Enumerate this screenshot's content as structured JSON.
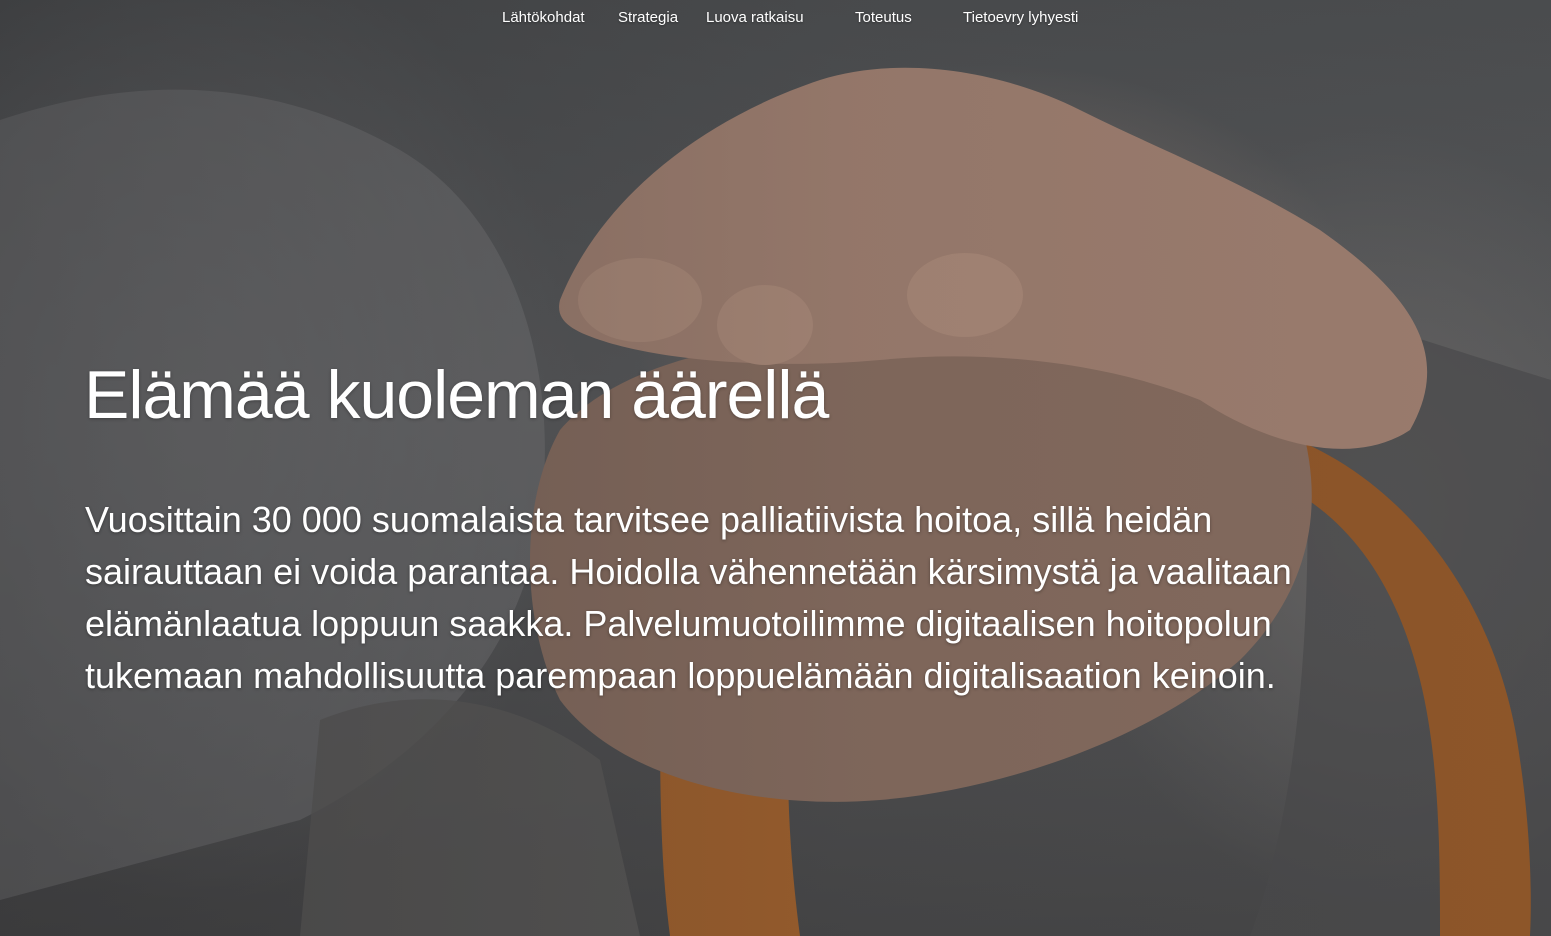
{
  "nav": {
    "items": [
      {
        "label": "Lähtökohdat"
      },
      {
        "label": "Strategia"
      },
      {
        "label": "Luova ratkaisu"
      },
      {
        "label": "Toteutus"
      },
      {
        "label": "Tietoevry lyhyesti"
      }
    ]
  },
  "hero": {
    "title": "Elämää kuoleman äärellä",
    "lead": "Vuosittain 30 000 suomalaista tarvitsee palliatiivista hoitoa, sillä heidän sairauttaan ei voida parantaa. Hoidolla vähennetään kärsimystä ja vaalitaan elämänlaatua loppuun saakka. Palvelumuotoilimme digitaalisen hoitopolun tukemaan mahdollisuutta parempaan loppuelämään digitalisaation keinoin."
  },
  "colors": {
    "text": "#ffffff",
    "background": "#58595b",
    "cane": "#a8652e",
    "skin": "#b08e7c"
  }
}
